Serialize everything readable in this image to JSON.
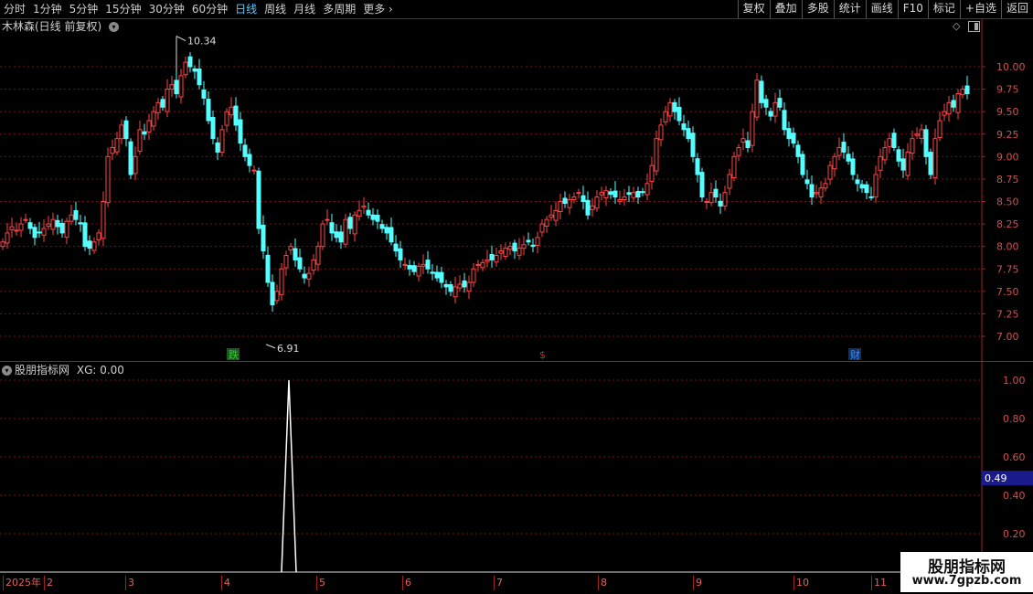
{
  "toolbar": {
    "periods": [
      "分时",
      "1分钟",
      "5分钟",
      "15分钟",
      "30分钟",
      "60分钟",
      "日线",
      "周线",
      "月线",
      "多周期",
      "更多"
    ],
    "active_period": "日线",
    "more_icon": "chevron-right-icon",
    "right_buttons": [
      "复权",
      "叠加",
      "多股",
      "统计",
      "画线",
      "F10",
      "标记",
      "+自选",
      "返回"
    ]
  },
  "main_panel": {
    "title": "木林森(日线 前复权)",
    "settings_icon": "chevron-down-circle-icon",
    "diamond_icon": "diamond-icon",
    "toggle_icon": "panel-toggle-icon",
    "high_label": "10.34",
    "low_label": "6.91",
    "marks": [
      {
        "text": "跌",
        "color": "#33cc33"
      },
      {
        "text": "$",
        "color": "#e02020"
      },
      {
        "text": "财",
        "color": "#3a8aff"
      }
    ],
    "y_ticks": [
      "10.00",
      "9.75",
      "9.50",
      "9.25",
      "9.00",
      "8.75",
      "8.50",
      "8.25",
      "8.00",
      "7.75",
      "7.50",
      "7.25",
      "7.00"
    ]
  },
  "indicator_panel": {
    "title": "股朋指标网",
    "series_label": "XG: 0.00",
    "y_ticks": [
      "1.00",
      "0.80",
      "0.60",
      "0.40",
      "0.20"
    ],
    "current_value": "0.49"
  },
  "date_axis": {
    "labels": [
      "2025年",
      "2",
      "3",
      "4",
      "5",
      "6",
      "7",
      "8",
      "9",
      "10",
      "11"
    ]
  },
  "watermark": {
    "name": "股朋指标网",
    "url": "www.7gpzb.com"
  },
  "colors": {
    "up": "#ff4444",
    "down": "#54ffff",
    "grid": "#7a1010",
    "active": "#5bc8ff"
  },
  "chart_data": {
    "type": "candlestick",
    "price_range": [
      6.85,
      10.4
    ],
    "high": 10.34,
    "low": 6.91,
    "closes": [
      8.05,
      8.15,
      8.22,
      8.18,
      8.25,
      8.3,
      8.2,
      8.1,
      8.15,
      8.2,
      8.25,
      8.3,
      8.22,
      8.15,
      8.28,
      8.35,
      8.3,
      8.25,
      8.0,
      7.98,
      8.05,
      8.15,
      8.5,
      9.0,
      9.1,
      9.2,
      9.35,
      9.2,
      8.8,
      9.0,
      9.3,
      9.25,
      9.4,
      9.5,
      9.6,
      9.55,
      9.75,
      9.8,
      9.7,
      9.9,
      10.05,
      10.0,
      9.95,
      9.8,
      9.65,
      9.4,
      9.2,
      9.05,
      9.3,
      9.5,
      9.55,
      9.35,
      9.15,
      9.0,
      8.9,
      8.85,
      8.2,
      7.95,
      7.6,
      7.35,
      7.5,
      7.75,
      7.9,
      8.0,
      7.85,
      7.75,
      7.65,
      7.7,
      7.85,
      8.0,
      8.25,
      8.3,
      8.15,
      8.1,
      8.05,
      8.3,
      8.2,
      8.35,
      8.4,
      8.45,
      8.35,
      8.3,
      8.28,
      8.2,
      8.15,
      8.05,
      7.95,
      7.85,
      7.8,
      7.75,
      7.72,
      7.78,
      7.8,
      7.75,
      7.7,
      7.65,
      7.6,
      7.55,
      7.5,
      7.55,
      7.58,
      7.55,
      7.6,
      7.75,
      7.8,
      7.82,
      7.85,
      7.85,
      7.9,
      7.95,
      7.98,
      8.0,
      7.95,
      7.98,
      8.02,
      8.05,
      8.0,
      8.1,
      8.25,
      8.3,
      8.35,
      8.4,
      8.5,
      8.48,
      8.52,
      8.55,
      8.6,
      8.5,
      8.35,
      8.45,
      8.55,
      8.6,
      8.62,
      8.58,
      8.55,
      8.52,
      8.55,
      8.58,
      8.6,
      8.55,
      8.6,
      8.7,
      8.9,
      9.2,
      9.35,
      9.5,
      9.6,
      9.5,
      9.4,
      9.3,
      9.2,
      9.0,
      8.8,
      8.55,
      8.5,
      8.6,
      8.55,
      8.45,
      8.6,
      8.8,
      9.0,
      9.1,
      9.2,
      9.1,
      9.5,
      9.85,
      9.6,
      9.55,
      9.45,
      9.6,
      9.55,
      9.3,
      9.2,
      9.15,
      9.0,
      8.8,
      8.7,
      8.55,
      8.6,
      8.65,
      8.7,
      8.9,
      9.0,
      9.1,
      9.05,
      8.95,
      8.8,
      8.7,
      8.65,
      8.6,
      8.55,
      8.8,
      9.0,
      9.1,
      9.2,
      9.1,
      8.95,
      8.85,
      9.05,
      9.2,
      9.25,
      9.3,
      9.0,
      8.8,
      9.2,
      9.4,
      9.5,
      9.6,
      9.55,
      9.7,
      9.75,
      9.7
    ]
  }
}
